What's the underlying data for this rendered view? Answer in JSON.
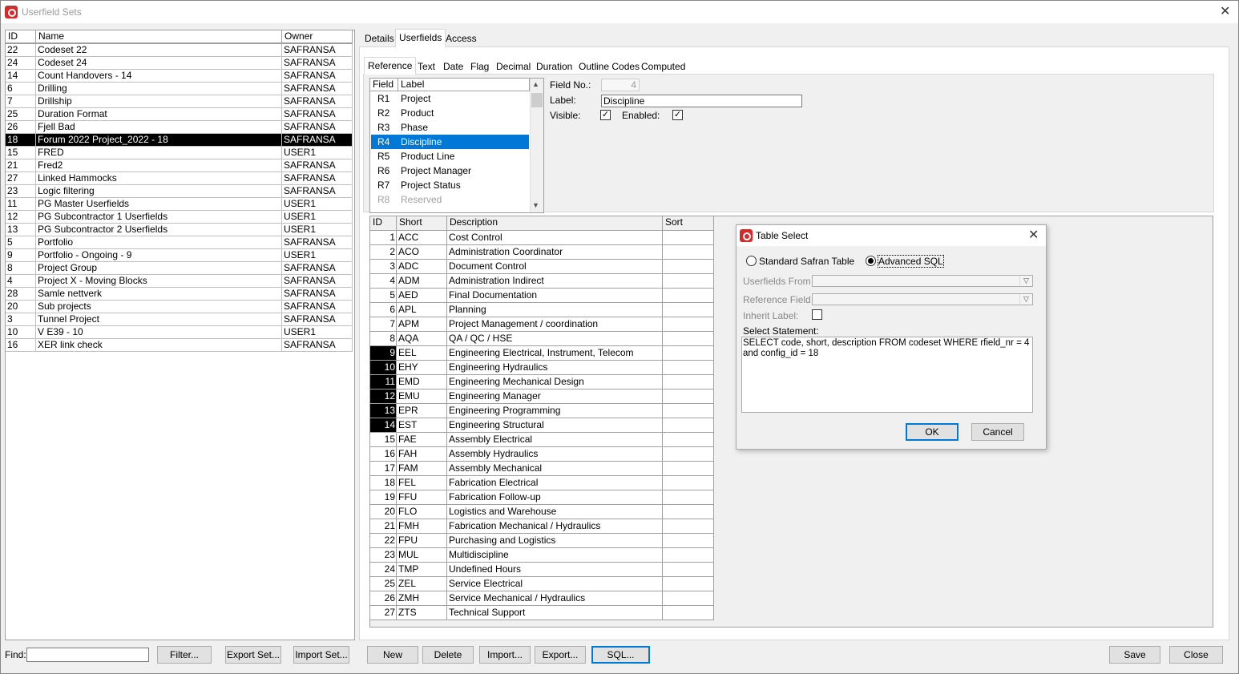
{
  "window": {
    "title": "Userfield Sets"
  },
  "sets": {
    "columns": [
      "ID",
      "Name",
      "Owner"
    ],
    "rows": [
      [
        "22",
        "Codeset 22",
        "SAFRANSA"
      ],
      [
        "24",
        "Codeset 24",
        "SAFRANSA"
      ],
      [
        "14",
        "Count Handovers - 14",
        "SAFRANSA"
      ],
      [
        "6",
        "Drilling",
        "SAFRANSA"
      ],
      [
        "7",
        "Drillship",
        "SAFRANSA"
      ],
      [
        "25",
        "Duration Format",
        "SAFRANSA"
      ],
      [
        "26",
        "Fjell Bad",
        "SAFRANSA"
      ],
      [
        "18",
        "Forum 2022 Project_2022 - 18",
        "SAFRANSA"
      ],
      [
        "15",
        "FRED",
        "USER1"
      ],
      [
        "21",
        "Fred2",
        "SAFRANSA"
      ],
      [
        "27",
        "Linked Hammocks",
        "SAFRANSA"
      ],
      [
        "23",
        "Logic filtering",
        "SAFRANSA"
      ],
      [
        "11",
        "PG Master Userfields",
        "USER1"
      ],
      [
        "12",
        "PG Subcontractor 1 Userfields",
        "USER1"
      ],
      [
        "13",
        "PG Subcontractor 2 Userfields",
        "USER1"
      ],
      [
        "5",
        "Portfolio",
        "SAFRANSA"
      ],
      [
        "9",
        "Portfolio - Ongoing - 9",
        "USER1"
      ],
      [
        "8",
        "Project Group",
        "SAFRANSA"
      ],
      [
        "4",
        "Project X - Moving Blocks",
        "SAFRANSA"
      ],
      [
        "28",
        "Samle nettverk",
        "SAFRANSA"
      ],
      [
        "20",
        "Sub projects",
        "SAFRANSA"
      ],
      [
        "3",
        "Tunnel Project",
        "SAFRANSA"
      ],
      [
        "10",
        "V E39 - 10",
        "USER1"
      ],
      [
        "16",
        "XER link check",
        "SAFRANSA"
      ]
    ]
  },
  "main_tabs": [
    "Details",
    "Userfields",
    "Access"
  ],
  "type_tabs": [
    "Reference",
    "Text",
    "Date",
    "Flag",
    "Decimal",
    "Duration",
    "Outline Codes",
    "Computed"
  ],
  "fields": {
    "columns": [
      "Field",
      "Label"
    ],
    "rows": [
      [
        "R1",
        "Project"
      ],
      [
        "R2",
        "Product"
      ],
      [
        "R3",
        "Phase"
      ],
      [
        "R4",
        "Discipline"
      ],
      [
        "R5",
        "Product Line"
      ],
      [
        "R6",
        "Project Manager"
      ],
      [
        "R7",
        "Project Status"
      ],
      [
        "R8",
        "Reserved"
      ]
    ]
  },
  "field_props": {
    "field_no_label": "Field No.:",
    "field_no_value": "4",
    "label_label": "Label:",
    "label_value": "Discipline",
    "visible_label": "Visible:",
    "enabled_label": "Enabled:",
    "visible_check": "✓",
    "enabled_check": "✓"
  },
  "codes": {
    "columns": [
      "ID",
      "Short",
      "Description",
      "Sort"
    ],
    "rows": [
      [
        "1",
        "ACC",
        "Cost Control",
        ""
      ],
      [
        "2",
        "ACO",
        "Administration Coordinator",
        ""
      ],
      [
        "3",
        "ADC",
        "Document Control",
        ""
      ],
      [
        "4",
        "ADM",
        "Administration Indirect",
        ""
      ],
      [
        "5",
        "AED",
        "Final Documentation",
        ""
      ],
      [
        "6",
        "APL",
        "Planning",
        ""
      ],
      [
        "7",
        "APM",
        "Project Management / coordination",
        ""
      ],
      [
        "8",
        "AQA",
        "QA / QC / HSE",
        ""
      ],
      [
        "9",
        "EEL",
        "Engineering Electrical, Instrument, Telecom",
        ""
      ],
      [
        "10",
        "EHY",
        "Engineering Hydraulics",
        ""
      ],
      [
        "11",
        "EMD",
        "Engineering Mechanical Design",
        ""
      ],
      [
        "12",
        "EMU",
        "Engineering Manager",
        ""
      ],
      [
        "13",
        "EPR",
        "Engineering Programming",
        ""
      ],
      [
        "14",
        "EST",
        "Engineering Structural",
        ""
      ],
      [
        "15",
        "FAE",
        "Assembly Electrical",
        ""
      ],
      [
        "16",
        "FAH",
        "Assembly Hydraulics",
        ""
      ],
      [
        "17",
        "FAM",
        "Assembly Mechanical",
        ""
      ],
      [
        "18",
        "FEL",
        "Fabrication Electrical",
        ""
      ],
      [
        "19",
        "FFU",
        "Fabrication Follow-up",
        ""
      ],
      [
        "20",
        "FLO",
        "Logistics and Warehouse",
        ""
      ],
      [
        "21",
        "FMH",
        "Fabrication Mechanical / Hydraulics",
        ""
      ],
      [
        "22",
        "FPU",
        "Purchasing and Logistics",
        ""
      ],
      [
        "23",
        "MUL",
        "Multidiscipline",
        ""
      ],
      [
        "24",
        "TMP",
        "Undefined Hours",
        ""
      ],
      [
        "25",
        "ZEL",
        "Service Electrical",
        ""
      ],
      [
        "26",
        "ZMH",
        "Service Mechanical / Hydraulics",
        ""
      ],
      [
        "27",
        "ZTS",
        "Technical Support",
        ""
      ]
    ]
  },
  "dialog": {
    "title": "Table Select",
    "radio_standard": "Standard Safran Table",
    "radio_advanced": "Advanced SQL",
    "userfields_from_label": "Userfields From :",
    "reference_field_label": "Reference Field :",
    "inherit_label": "Inherit Label:",
    "select_statement_label": "Select Statement:",
    "sql": "SELECT code, short, description FROM codeset WHERE rfield_nr = 4 and config_id = 18",
    "ok": "OK",
    "cancel": "Cancel"
  },
  "bottom": {
    "find_label": "Find:",
    "find_value": "",
    "filter": "Filter...",
    "export_set": "Export Set...",
    "import_set": "Import Set...",
    "new": "New",
    "delete": "Delete",
    "import": "Import...",
    "export": "Export...",
    "sql": "SQL...",
    "save": "Save",
    "close": "Close"
  }
}
